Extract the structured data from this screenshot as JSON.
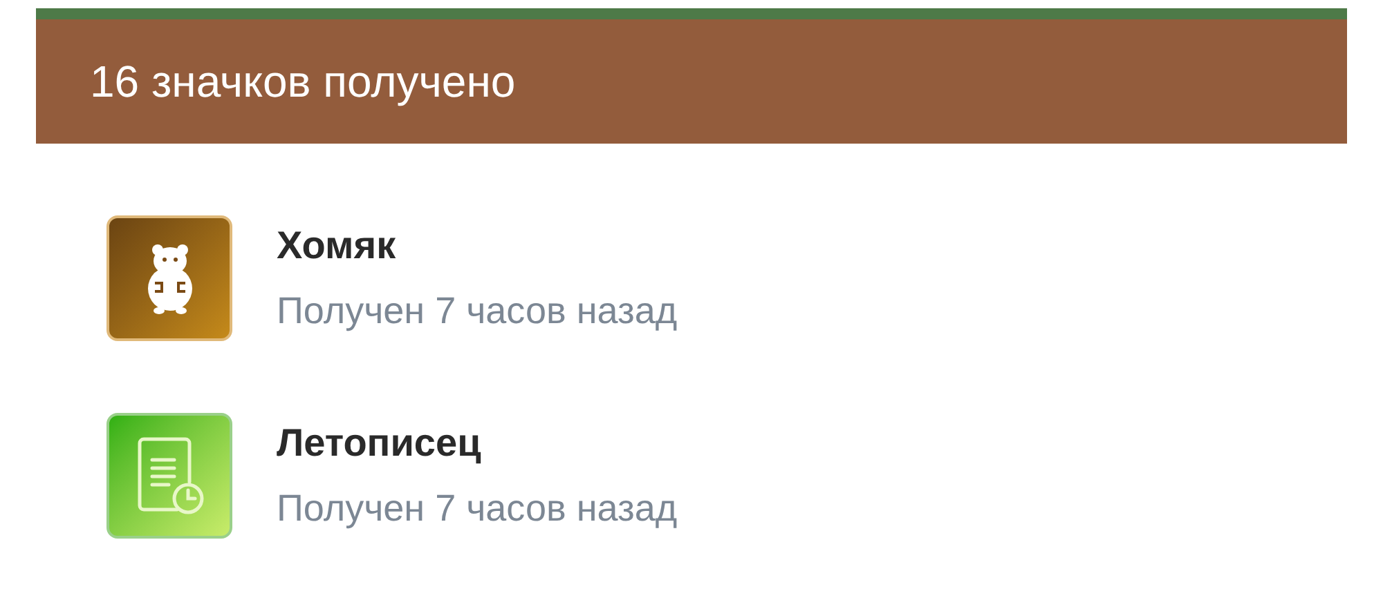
{
  "header": {
    "title": "16 значков получено"
  },
  "badges": [
    {
      "kind": "hamster",
      "name": "Хомяк",
      "subtitle": "Получен 7 часов назад"
    },
    {
      "kind": "chronicle",
      "name": "Летописец",
      "subtitle": "Получен 7 часов назад"
    }
  ]
}
